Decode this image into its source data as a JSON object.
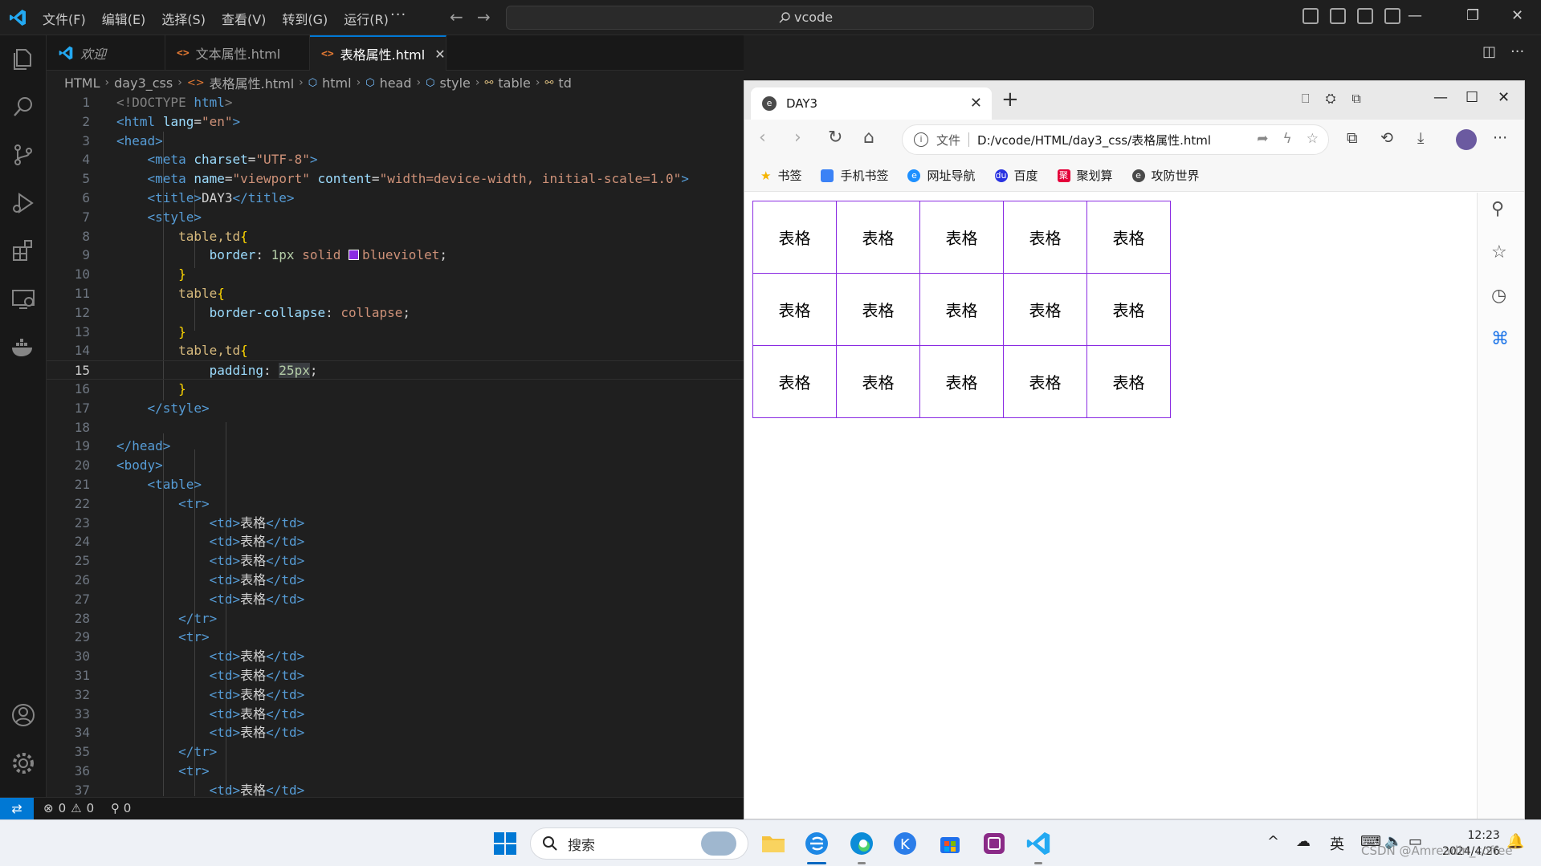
{
  "titlebar": {
    "menu": [
      "文件(F)",
      "编辑(E)",
      "选择(S)",
      "查看(V)",
      "转到(G)",
      "运行(R)"
    ],
    "more": "···",
    "search_text": "vcode"
  },
  "tabs": [
    {
      "label": "欢迎",
      "active": false
    },
    {
      "label": "文本属性.html",
      "active": false
    },
    {
      "label": "表格属性.html",
      "active": true
    }
  ],
  "breadcrumb": [
    "HTML",
    "day3_css",
    "表格属性.html",
    "html",
    "head",
    "style",
    "table",
    "td"
  ],
  "code_lines": [
    {
      "n": "1"
    },
    {
      "n": "2"
    },
    {
      "n": "3"
    },
    {
      "n": "4"
    },
    {
      "n": "5"
    },
    {
      "n": "6"
    },
    {
      "n": "7"
    },
    {
      "n": "8"
    },
    {
      "n": "9"
    },
    {
      "n": "10"
    },
    {
      "n": "11"
    },
    {
      "n": "12"
    },
    {
      "n": "13"
    },
    {
      "n": "14"
    },
    {
      "n": "15"
    },
    {
      "n": "16"
    },
    {
      "n": "17"
    },
    {
      "n": "18"
    },
    {
      "n": "19"
    },
    {
      "n": "20"
    },
    {
      "n": "21"
    },
    {
      "n": "22"
    },
    {
      "n": "23"
    },
    {
      "n": "24"
    },
    {
      "n": "25"
    },
    {
      "n": "26"
    },
    {
      "n": "27"
    },
    {
      "n": "28"
    },
    {
      "n": "29"
    },
    {
      "n": "30"
    },
    {
      "n": "31"
    },
    {
      "n": "32"
    },
    {
      "n": "33"
    },
    {
      "n": "34"
    },
    {
      "n": "35"
    },
    {
      "n": "36"
    },
    {
      "n": "37"
    }
  ],
  "code": {
    "doctype": "<!DOCTYPE",
    "html_kw": "html",
    "gt": ">",
    "html_open": "<html",
    "lang_attr": "lang",
    "lang_val": "\"en\"",
    "head_open": "<head>",
    "meta": "<meta",
    "charset_attr": "charset",
    "charset_val": "\"UTF-8\"",
    "name_attr": "name",
    "name_val": "\"viewport\"",
    "content_attr": "content",
    "content_val": "\"width=device-width, initial-scale=1.0\"",
    "title_open": "<title>",
    "title_text": "DAY3",
    "title_close": "</title>",
    "style_open": "<style>",
    "sel1": "table,td",
    "lbrace": "{",
    "rbrace": "}",
    "prop_border": "border",
    "colon": ": ",
    "num_1px": "1px",
    "solid": " solid ",
    "color_name": "blueviolet",
    "semi": ";",
    "sel2": "table",
    "prop_bc": "border-collapse",
    "val_collapse": "collapse",
    "sel3": "table,td",
    "prop_padding": "padding",
    "val_25px": "25px",
    "style_close": "</style>",
    "head_close": "</head>",
    "body_open": "<body>",
    "table_open": "<table>",
    "tr_open": "<tr>",
    "tr_close": "</tr>",
    "td_open": "<td>",
    "td_text": "表格",
    "td_close": "</td>",
    "eq": "="
  },
  "statusbar": {
    "errors": "0",
    "warnings": "0",
    "ports": "0"
  },
  "browser": {
    "tab_title": "DAY3",
    "address_prefix": "文件",
    "url": "D:/vcode/HTML/day3_css/表格属性.html",
    "bookmarks": [
      "书签",
      "手机书签",
      "网址导航",
      "百度",
      "聚划算",
      "攻防世界"
    ],
    "table_rows": [
      [
        "表格",
        "表格",
        "表格",
        "表格",
        "表格"
      ],
      [
        "表格",
        "表格",
        "表格",
        "表格",
        "表格"
      ],
      [
        "表格",
        "表格",
        "表格",
        "表格",
        "表格"
      ]
    ],
    "table_border_color": "#8a2be2"
  },
  "taskbar": {
    "search_label": "搜索",
    "ime": "英",
    "time": "12:23",
    "date": "2024/4/26"
  },
  "watermark": "CSDN @Amreadin_coffee",
  "colors": {
    "accent": "#0078d4",
    "editor_bg": "#1f1f1f",
    "blueviolet": "#8a2be2"
  }
}
